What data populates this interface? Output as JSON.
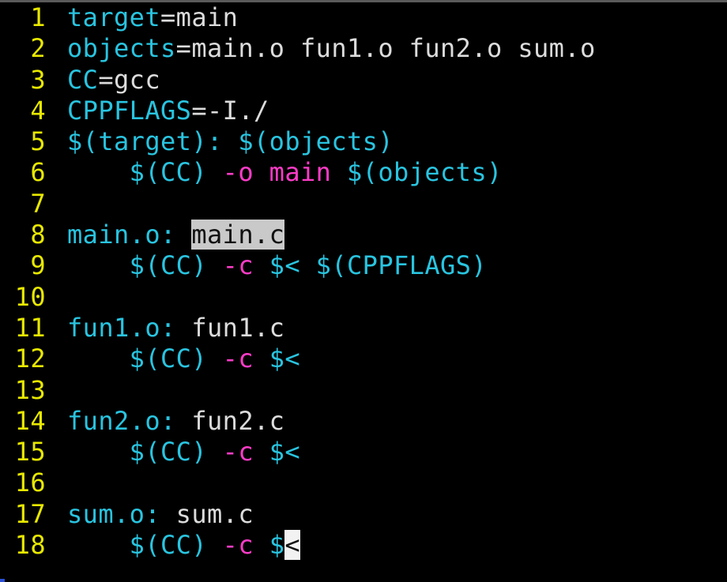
{
  "editor": {
    "colors": {
      "background": "#000000",
      "line_number": "#e8e800",
      "cyan": "#29c4e0",
      "white": "#dcdcdc",
      "magenta": "#ff3cc8",
      "highlight_bg": "#c9c9c9",
      "cursor_bg": "#f2f2f2"
    },
    "lines": [
      {
        "num": "1",
        "segs": [
          {
            "t": "target",
            "c": "cyan"
          },
          {
            "t": "=main",
            "c": "white"
          }
        ]
      },
      {
        "num": "2",
        "segs": [
          {
            "t": "objects",
            "c": "cyan"
          },
          {
            "t": "=main.o fun1.o fun2.o sum.o",
            "c": "white"
          }
        ]
      },
      {
        "num": "3",
        "segs": [
          {
            "t": "CC",
            "c": "cyan"
          },
          {
            "t": "=gcc",
            "c": "white"
          }
        ]
      },
      {
        "num": "4",
        "segs": [
          {
            "t": "CPPFLAGS",
            "c": "cyan"
          },
          {
            "t": "=-I./",
            "c": "white"
          }
        ]
      },
      {
        "num": "5",
        "segs": [
          {
            "t": "$(target): $(objects)",
            "c": "cyan"
          }
        ]
      },
      {
        "num": "6",
        "segs": [
          {
            "t": "    ",
            "c": "white"
          },
          {
            "t": "$(CC)",
            "c": "cyan"
          },
          {
            "t": " ",
            "c": "white"
          },
          {
            "t": "-o main",
            "c": "mag"
          },
          {
            "t": " ",
            "c": "white"
          },
          {
            "t": "$(objects)",
            "c": "cyan"
          }
        ]
      },
      {
        "num": "7",
        "segs": []
      },
      {
        "num": "8",
        "segs": [
          {
            "t": "main.o: ",
            "c": "cyan"
          },
          {
            "t": "main.c",
            "c": "hl"
          }
        ]
      },
      {
        "num": "9",
        "segs": [
          {
            "t": "    ",
            "c": "white"
          },
          {
            "t": "$(CC)",
            "c": "cyan"
          },
          {
            "t": " ",
            "c": "white"
          },
          {
            "t": "-c",
            "c": "mag"
          },
          {
            "t": " ",
            "c": "white"
          },
          {
            "t": "$< $(CPPFLAGS)",
            "c": "cyan"
          }
        ]
      },
      {
        "num": "10",
        "segs": []
      },
      {
        "num": "11",
        "segs": [
          {
            "t": "fun1.o: ",
            "c": "cyan"
          },
          {
            "t": "fun1.c",
            "c": "white"
          }
        ]
      },
      {
        "num": "12",
        "segs": [
          {
            "t": "    ",
            "c": "white"
          },
          {
            "t": "$(CC)",
            "c": "cyan"
          },
          {
            "t": " ",
            "c": "white"
          },
          {
            "t": "-c",
            "c": "mag"
          },
          {
            "t": " ",
            "c": "white"
          },
          {
            "t": "$<",
            "c": "cyan"
          }
        ]
      },
      {
        "num": "13",
        "segs": []
      },
      {
        "num": "14",
        "segs": [
          {
            "t": "fun2.o: ",
            "c": "cyan"
          },
          {
            "t": "fun2.c",
            "c": "white"
          }
        ]
      },
      {
        "num": "15",
        "segs": [
          {
            "t": "    ",
            "c": "white"
          },
          {
            "t": "$(CC)",
            "c": "cyan"
          },
          {
            "t": " ",
            "c": "white"
          },
          {
            "t": "-c",
            "c": "mag"
          },
          {
            "t": " ",
            "c": "white"
          },
          {
            "t": "$<",
            "c": "cyan"
          }
        ]
      },
      {
        "num": "16",
        "segs": []
      },
      {
        "num": "17",
        "segs": [
          {
            "t": "sum.o: ",
            "c": "cyan"
          },
          {
            "t": "sum.c",
            "c": "white"
          }
        ]
      },
      {
        "num": "18",
        "segs": [
          {
            "t": "    ",
            "c": "white"
          },
          {
            "t": "$(CC)",
            "c": "cyan"
          },
          {
            "t": " ",
            "c": "white"
          },
          {
            "t": "-c",
            "c": "mag"
          },
          {
            "t": " ",
            "c": "white"
          },
          {
            "t": "$",
            "c": "cyan"
          },
          {
            "t": "<",
            "c": "cursor"
          }
        ]
      }
    ]
  }
}
